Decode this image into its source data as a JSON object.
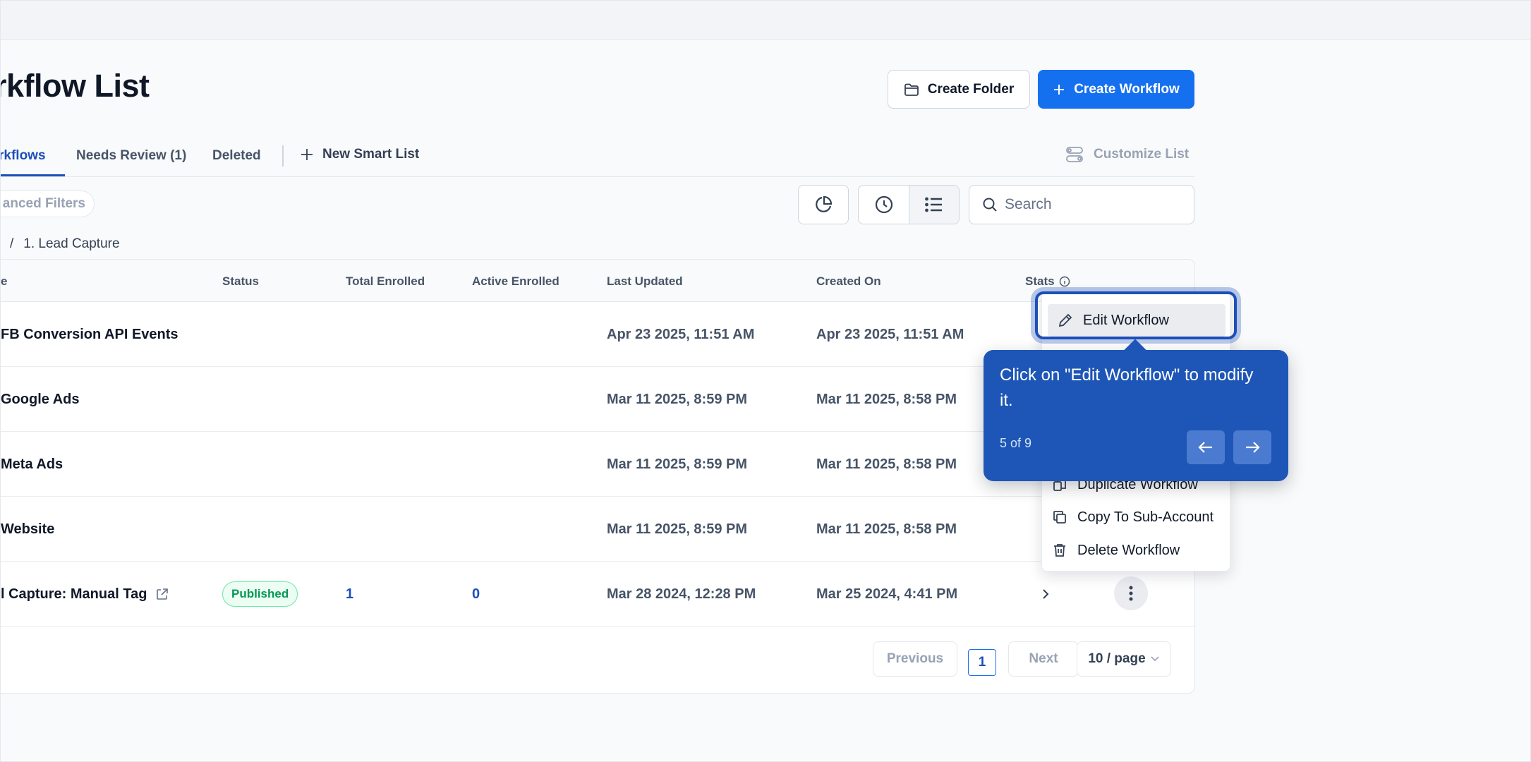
{
  "page": {
    "title": "rkflow List"
  },
  "header": {
    "create_folder": "Create Folder",
    "create_workflow": "Create Workflow"
  },
  "tabs": {
    "active": "rkflows",
    "needs_review": "Needs Review (1)",
    "deleted": "Deleted",
    "new_smart_list": "New Smart List",
    "customize_list": "Customize List"
  },
  "filters": {
    "advanced_filters": "anced Filters"
  },
  "search": {
    "placeholder": "Search"
  },
  "breadcrumb": {
    "separator": "/",
    "current": "1. Lead Capture"
  },
  "table": {
    "columns": {
      "name": "e",
      "status": "Status",
      "total_enrolled": "Total Enrolled",
      "active_enrolled": "Active Enrolled",
      "last_updated": "Last Updated",
      "created_on": "Created On",
      "stats": "Stats"
    },
    "rows": [
      {
        "name": "FB Conversion API Events",
        "status": "",
        "total": "",
        "active": "",
        "last_updated": "Apr 23 2025, 11:51 AM",
        "created_on": "Apr 23 2025, 11:51 AM"
      },
      {
        "name": "Google Ads",
        "status": "",
        "total": "",
        "active": "",
        "last_updated": "Mar 11 2025, 8:59 PM",
        "created_on": "Mar 11 2025, 8:58 PM"
      },
      {
        "name": "Meta Ads",
        "status": "",
        "total": "",
        "active": "",
        "last_updated": "Mar 11 2025, 8:59 PM",
        "created_on": "Mar 11 2025, 8:58 PM"
      },
      {
        "name": "Website",
        "status": "",
        "total": "",
        "active": "",
        "last_updated": "Mar 11 2025, 8:59 PM",
        "created_on": "Mar 11 2025, 8:58 PM"
      },
      {
        "name": "l Capture: Manual Tag",
        "status": "Published",
        "total": "1",
        "active": "0",
        "last_updated": "Mar 28 2024, 12:28 PM",
        "created_on": "Mar 25 2024, 4:41 PM"
      }
    ]
  },
  "pagination": {
    "previous": "Previous",
    "current": "1",
    "next": "Next",
    "page_size": "10 / page"
  },
  "context_menu": {
    "items": [
      "Edit Workflow",
      "Duplicate Workflow",
      "Copy To Sub-Account",
      "Delete Workflow"
    ]
  },
  "tour": {
    "message": "Click on \"Edit Workflow\" to modify it.",
    "step": "5 of 9"
  },
  "colors": {
    "primary": "#1570ef",
    "tour": "#1d56b6",
    "published": "#039855"
  }
}
